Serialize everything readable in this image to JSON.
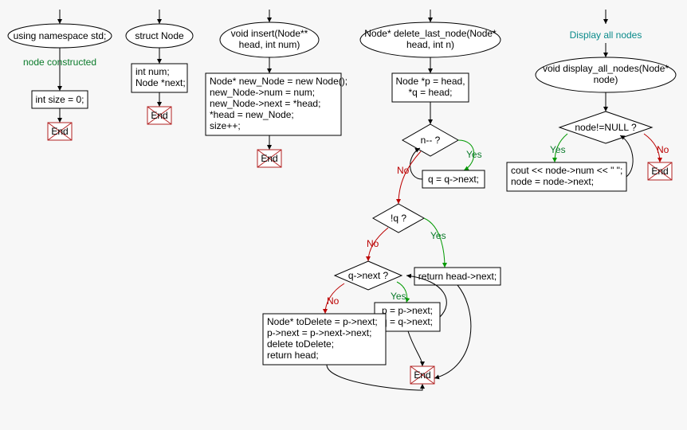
{
  "col1": {
    "ellipse": "using namespace std;",
    "anno": "node constructed",
    "box": "int size = 0;",
    "end": "End"
  },
  "col2": {
    "ellipse": "struct Node",
    "box_l1": "int num;",
    "box_l2": "Node *next;",
    "end": "End"
  },
  "col3": {
    "ellipse_l1": "void insert(Node**",
    "ellipse_l2": "head, int num)",
    "box_l1": "Node* new_Node = new Node();",
    "box_l2": "new_Node->num = num;",
    "box_l3": "new_Node->next = *head;",
    "box_l4": "*head = new_Node;",
    "box_l5": "size++;",
    "end": "End"
  },
  "col4": {
    "ellipse_l1": "Node* delete_last_node(Node*",
    "ellipse_l2": "head, int n)",
    "box1_l1": "Node *p = head,",
    "box1_l2": "*q = head;",
    "d1": "n-- ?",
    "loop1": "q = q->next;",
    "d2": "!q ?",
    "ret1": "return head->next;",
    "d3": "q->next ?",
    "loop2_l1": "p = p->next;",
    "loop2_l2": "q = q->next;",
    "final_l1": "Node* toDelete = p->next;",
    "final_l2": "p->next = p->next->next;",
    "final_l3": "delete toDelete;",
    "final_l4": "return head;",
    "end": "End",
    "yes": "Yes",
    "no": "No"
  },
  "col5": {
    "title": "Display all nodes",
    "ellipse_l1": "void display_all_nodes(Node*",
    "ellipse_l2": "node)",
    "d1": "node!=NULL ?",
    "box_l1": "cout << node->num << \" \";",
    "box_l2": "node = node->next;",
    "end": "End",
    "yes": "Yes",
    "no": "No"
  }
}
